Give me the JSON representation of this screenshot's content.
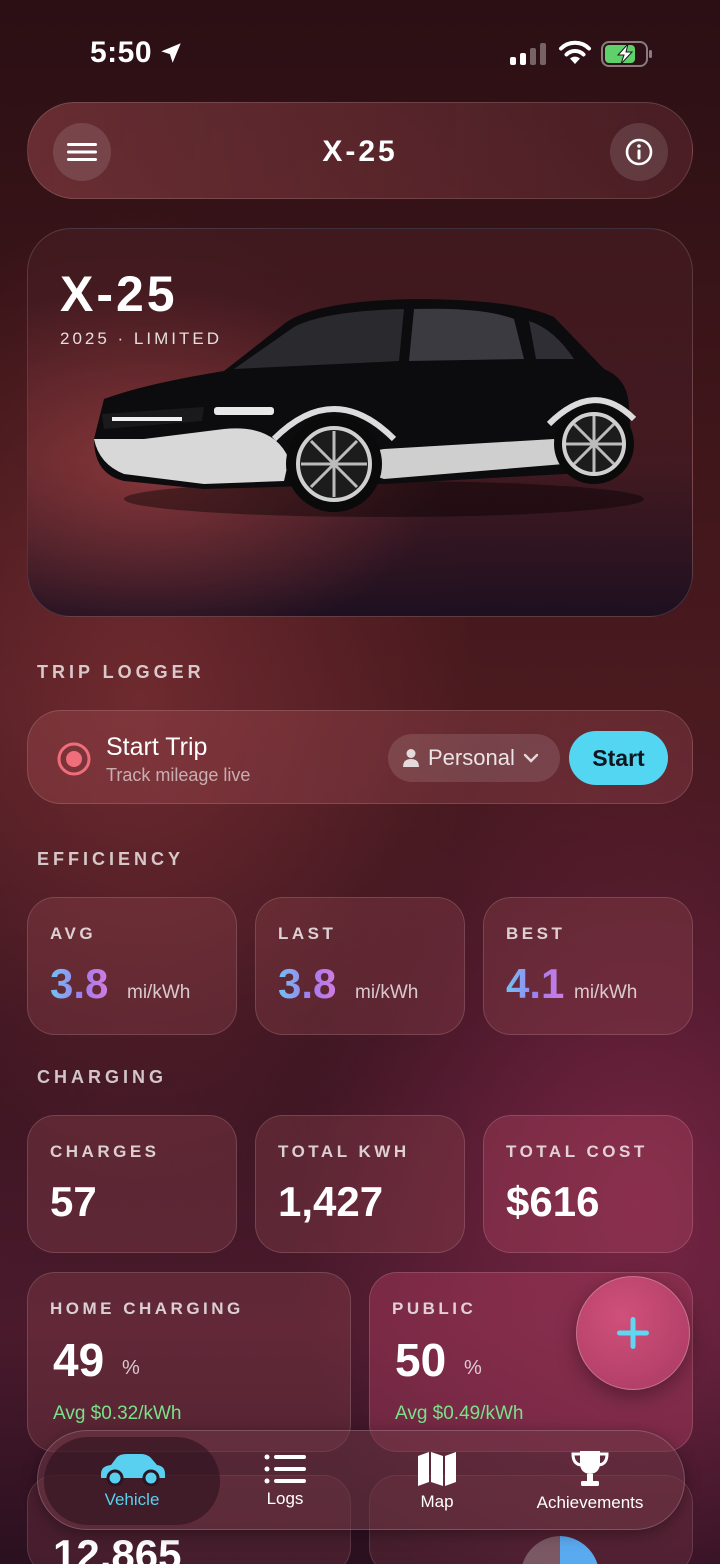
{
  "status_bar": {
    "time": "5:50"
  },
  "header": {
    "title": "X-25"
  },
  "hero": {
    "model": "X-25",
    "subtitle": "2025 · LIMITED"
  },
  "sections": {
    "trip_logger": "TRIP LOGGER",
    "efficiency": "EFFICIENCY",
    "charging": "CHARGING"
  },
  "trip": {
    "title": "Start Trip",
    "subtitle": "Track mileage live",
    "purpose": "Personal",
    "start_label": "Start"
  },
  "efficiency": [
    {
      "label": "AVG",
      "value": "3.8",
      "unit": "mi/kWh"
    },
    {
      "label": "LAST",
      "value": "3.8",
      "unit": "mi/kWh"
    },
    {
      "label": "BEST",
      "value": "4.1",
      "unit": "mi/kWh"
    }
  ],
  "charging": [
    {
      "label": "CHARGES",
      "value": "57"
    },
    {
      "label": "TOTAL KWH",
      "value": "1,427"
    },
    {
      "label": "TOTAL COST",
      "value": "$616"
    }
  ],
  "charging_split": [
    {
      "label": "HOME CHARGING",
      "value": "49",
      "unit": "%",
      "avg": "Avg $0.32/kWh",
      "fraction": 0.49
    },
    {
      "label": "PUBLIC",
      "value": "50",
      "unit": "%",
      "avg": "Avg $0.49/kWh",
      "fraction": 0.5
    }
  ],
  "peek": {
    "left_value": "12,865"
  },
  "fab": {
    "icon": "plus-icon"
  },
  "tabs": [
    {
      "label": "Vehicle",
      "icon": "car-icon",
      "active": true
    },
    {
      "label": "Logs",
      "icon": "list-icon",
      "active": false
    },
    {
      "label": "Map",
      "icon": "map-icon",
      "active": false
    },
    {
      "label": "Achievements",
      "icon": "trophy-icon",
      "active": false
    }
  ],
  "colors": {
    "accent": "#52d6f2",
    "positive": "#7be08a",
    "fab": "#c04a72"
  }
}
